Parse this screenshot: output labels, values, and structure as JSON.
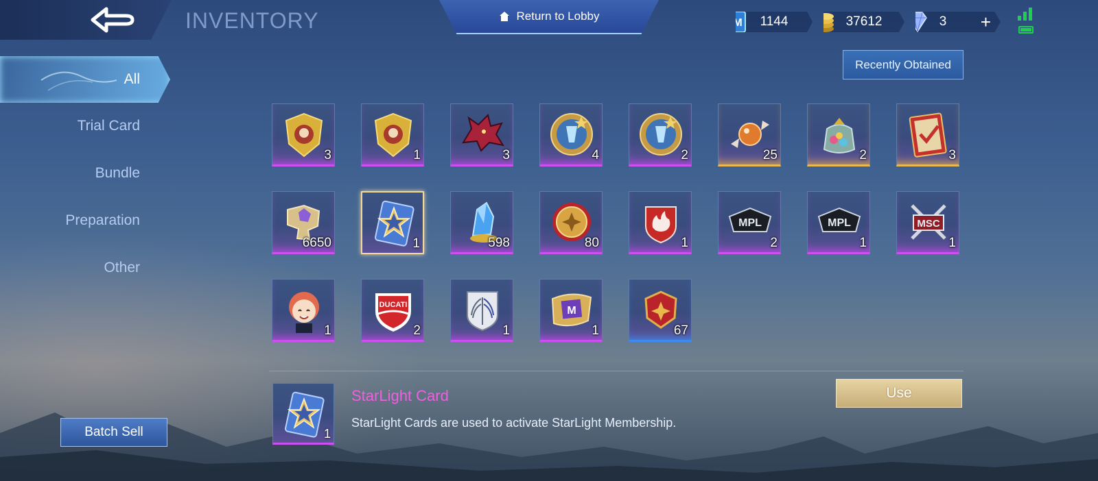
{
  "header": {
    "title": "INVENTORY",
    "lobby_label": "Return to Lobby"
  },
  "currencies": [
    {
      "icon": "m-ticket-icon",
      "value": "1144"
    },
    {
      "icon": "battle-points-icon",
      "value": "37612"
    },
    {
      "icon": "diamond-icon",
      "value": "3",
      "add_label": "+"
    }
  ],
  "status": {
    "signal": "signal-icon",
    "battery": "battery-icon"
  },
  "sidebar": {
    "items": [
      {
        "label": "All",
        "active": true
      },
      {
        "label": "Trial Card"
      },
      {
        "label": "Bundle"
      },
      {
        "label": "Preparation"
      },
      {
        "label": "Other"
      }
    ],
    "batch_sell_label": "Batch Sell"
  },
  "recent_button_label": "Recently Obtained",
  "items": [
    {
      "icon": "shield-emblem-icon",
      "count": "3",
      "rarity": "purple"
    },
    {
      "icon": "shield-emblem-icon",
      "count": "1",
      "rarity": "purple"
    },
    {
      "icon": "dragon-head-icon",
      "count": "3",
      "rarity": "purple"
    },
    {
      "icon": "crystal-emblem-icon",
      "count": "4",
      "rarity": "purple"
    },
    {
      "icon": "crystal-emblem-icon",
      "count": "2",
      "rarity": "purple"
    },
    {
      "icon": "candy-icon",
      "count": "25",
      "rarity": "gold"
    },
    {
      "icon": "candy-bag-icon",
      "count": "2",
      "rarity": "gold"
    },
    {
      "icon": "checkmark-card-icon",
      "count": "3",
      "rarity": "gold"
    },
    {
      "icon": "fragment-icon",
      "count": "6650",
      "rarity": "purple"
    },
    {
      "icon": "starlight-card-icon",
      "count": "1",
      "rarity": "purple",
      "selected": true
    },
    {
      "icon": "crystal-shard-icon",
      "count": "598",
      "rarity": "purple"
    },
    {
      "icon": "shuriken-coin-icon",
      "count": "80",
      "rarity": "purple"
    },
    {
      "icon": "fire-emblem-icon",
      "count": "1",
      "rarity": "purple"
    },
    {
      "icon": "mpl-logo-icon",
      "count": "2",
      "rarity": "purple"
    },
    {
      "icon": "mpl-logo-icon",
      "count": "1",
      "rarity": "purple"
    },
    {
      "icon": "msc-logo-icon",
      "count": "1",
      "rarity": "purple"
    },
    {
      "icon": "avatar-chibi-icon",
      "count": "1",
      "rarity": "purple"
    },
    {
      "icon": "ducati-logo-icon",
      "count": "2",
      "rarity": "purple"
    },
    {
      "icon": "wings-emblem-icon",
      "count": "1",
      "rarity": "purple"
    },
    {
      "icon": "film-ticket-icon",
      "count": "1",
      "rarity": "purple"
    },
    {
      "icon": "shuriken-badge-icon",
      "count": "67",
      "rarity": "blue"
    }
  ],
  "detail": {
    "icon": "starlight-card-icon",
    "count": "1",
    "name": "StarLight Card",
    "description": "StarLight Cards are used to activate StarLight Membership.",
    "use_label": "Use"
  },
  "colors": {
    "accent": "#ef5fe0",
    "rarity_purple": "#cd4ff0",
    "rarity_gold": "#e8b855",
    "rarity_blue": "#3d8bf0",
    "use_button": "#d9c18c"
  }
}
